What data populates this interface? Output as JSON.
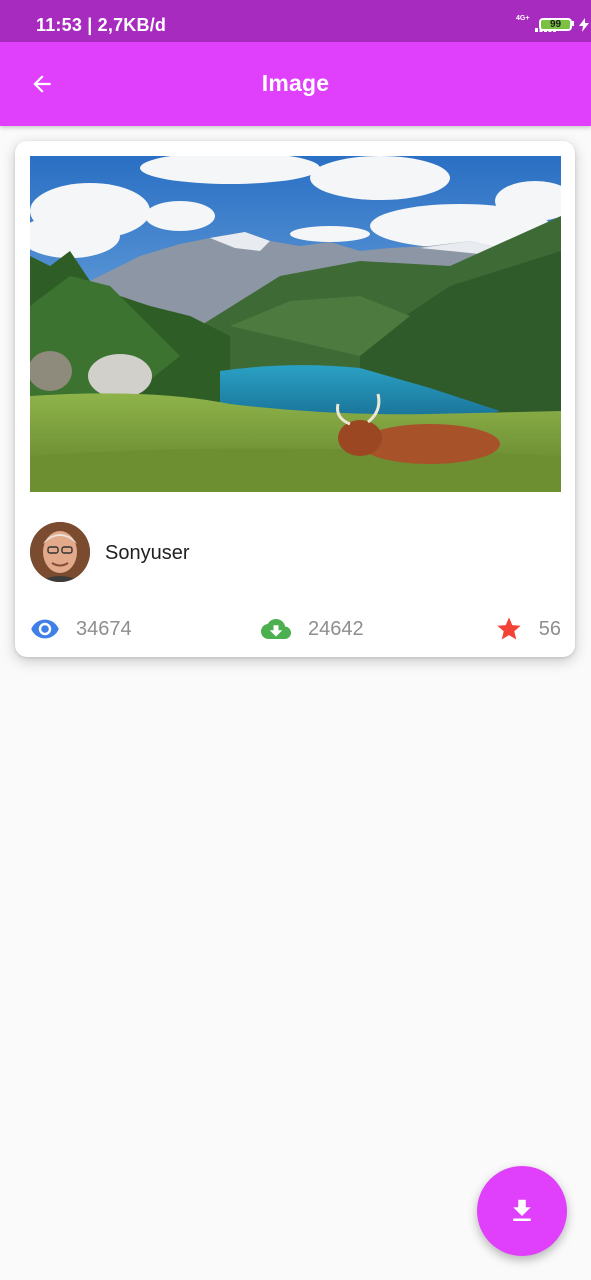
{
  "status_bar": {
    "time": "11:53 | 2,7KB/d",
    "network_label": "4G+",
    "battery_level": "99",
    "icons": [
      "signal-icon",
      "battery-icon",
      "charging-icon"
    ]
  },
  "app_bar": {
    "title": "Image",
    "back_icon": "arrow-left-icon",
    "color": "#e040fb"
  },
  "card": {
    "photo_icon": "landscape-photo",
    "author": {
      "name": "Sonyuser",
      "avatar_icon": "avatar"
    },
    "stats": {
      "views": {
        "value": "34674",
        "icon": "eye-icon",
        "color": "#3f80e8"
      },
      "downloads": {
        "value": "24642",
        "icon": "cloud-download-icon",
        "color": "#4caf50"
      },
      "favorites": {
        "value": "56",
        "icon": "star-icon",
        "color": "#f44336"
      }
    }
  },
  "fab": {
    "icon": "download-icon",
    "color": "#e040fb"
  },
  "colors": {
    "status_bar": "#a82bbf",
    "background": "#fafafa"
  }
}
